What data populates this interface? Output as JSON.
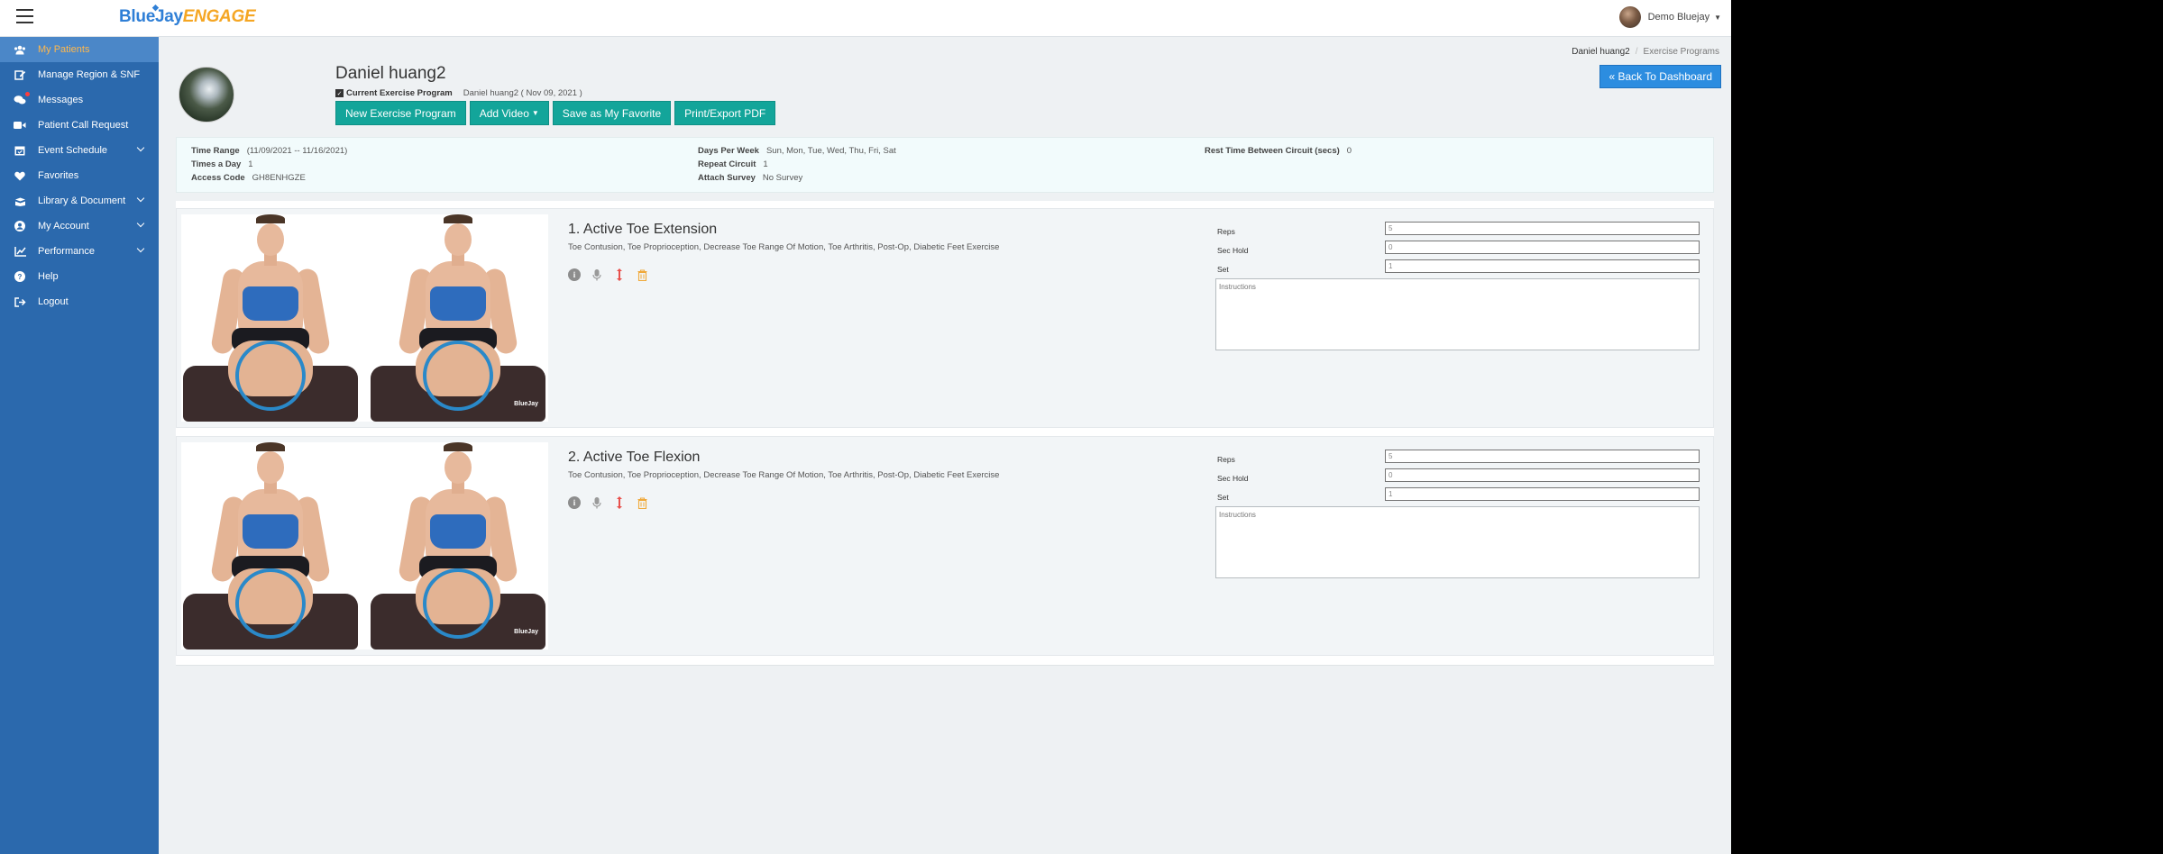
{
  "header": {
    "logo_part1": "BlueJay",
    "logo_part2": "ENGAGE",
    "user_name": "Demo Bluejay"
  },
  "sidebar": {
    "items": [
      {
        "label": "My Patients",
        "icon": "users-icon",
        "active": true
      },
      {
        "label": "Manage Region & SNF",
        "icon": "edit-icon"
      },
      {
        "label": "Messages",
        "icon": "chat-icon",
        "badge": true
      },
      {
        "label": "Patient Call Request",
        "icon": "video-icon"
      },
      {
        "label": "Event Schedule",
        "icon": "calendar-icon",
        "chevron": true
      },
      {
        "label": "Favorites",
        "icon": "heart-icon"
      },
      {
        "label": "Library & Document",
        "icon": "book-icon",
        "chevron": true
      },
      {
        "label": "My Account",
        "icon": "user-circle-icon",
        "chevron": true
      },
      {
        "label": "Performance",
        "icon": "chart-icon",
        "chevron": true
      },
      {
        "label": "Help",
        "icon": "help-icon"
      },
      {
        "label": "Logout",
        "icon": "logout-icon"
      }
    ]
  },
  "breadcrumb": {
    "patient": "Daniel huang2",
    "section": "Exercise Programs"
  },
  "back_button": "« Back To Dashboard",
  "patient": {
    "name": "Daniel huang2",
    "current_program_label": "Current Exercise Program",
    "current_program_value": "Daniel huang2 ( Nov 09, 2021 )"
  },
  "actions": {
    "new_program": "New Exercise Program",
    "add_video": "Add Video",
    "save_favorite": "Save as My Favorite",
    "print_pdf": "Print/Export PDF"
  },
  "program_info": {
    "time_range_label": "Time Range",
    "time_range_value": "(11/09/2021 -- 11/16/2021)",
    "times_day_label": "Times a Day",
    "times_day_value": "1",
    "access_code_label": "Access Code",
    "access_code_value": "GH8ENHGZE",
    "days_week_label": "Days Per Week",
    "days_week_value": "Sun, Mon, Tue, Wed, Thu, Fri, Sat",
    "repeat_label": "Repeat Circuit",
    "repeat_value": "1",
    "survey_label": "Attach Survey",
    "survey_value": "No Survey",
    "rest_label": "Rest Time Between Circuit (secs)",
    "rest_value": "0"
  },
  "exercises": [
    {
      "title": "1. Active Toe Extension",
      "tags": "Toe Contusion, Toe Proprioception, Decrease Toe Range Of Motion, Toe Arthritis, Post-Op, Diabetic Feet Exercise",
      "brand": "BlueJay",
      "reps_label": "Reps",
      "reps": "5",
      "hold_label": "Sec Hold",
      "hold": "0",
      "set_label": "Set",
      "set": "1",
      "instructions_placeholder": "Instructions"
    },
    {
      "title": "2. Active Toe Flexion",
      "tags": "Toe Contusion, Toe Proprioception, Decrease Toe Range Of Motion, Toe Arthritis, Post-Op, Diabetic Feet Exercise",
      "brand": "BlueJay",
      "reps_label": "Reps",
      "reps": "5",
      "hold_label": "Sec Hold",
      "hold": "0",
      "set_label": "Set",
      "set": "1",
      "instructions_placeholder": "Instructions"
    }
  ],
  "colors": {
    "sidebar": "#2b69ad",
    "sidebar_active": "#4b87c8",
    "active_text": "#ffb84d",
    "teal_button": "#13a59a",
    "blue_button": "#2c8de0"
  }
}
